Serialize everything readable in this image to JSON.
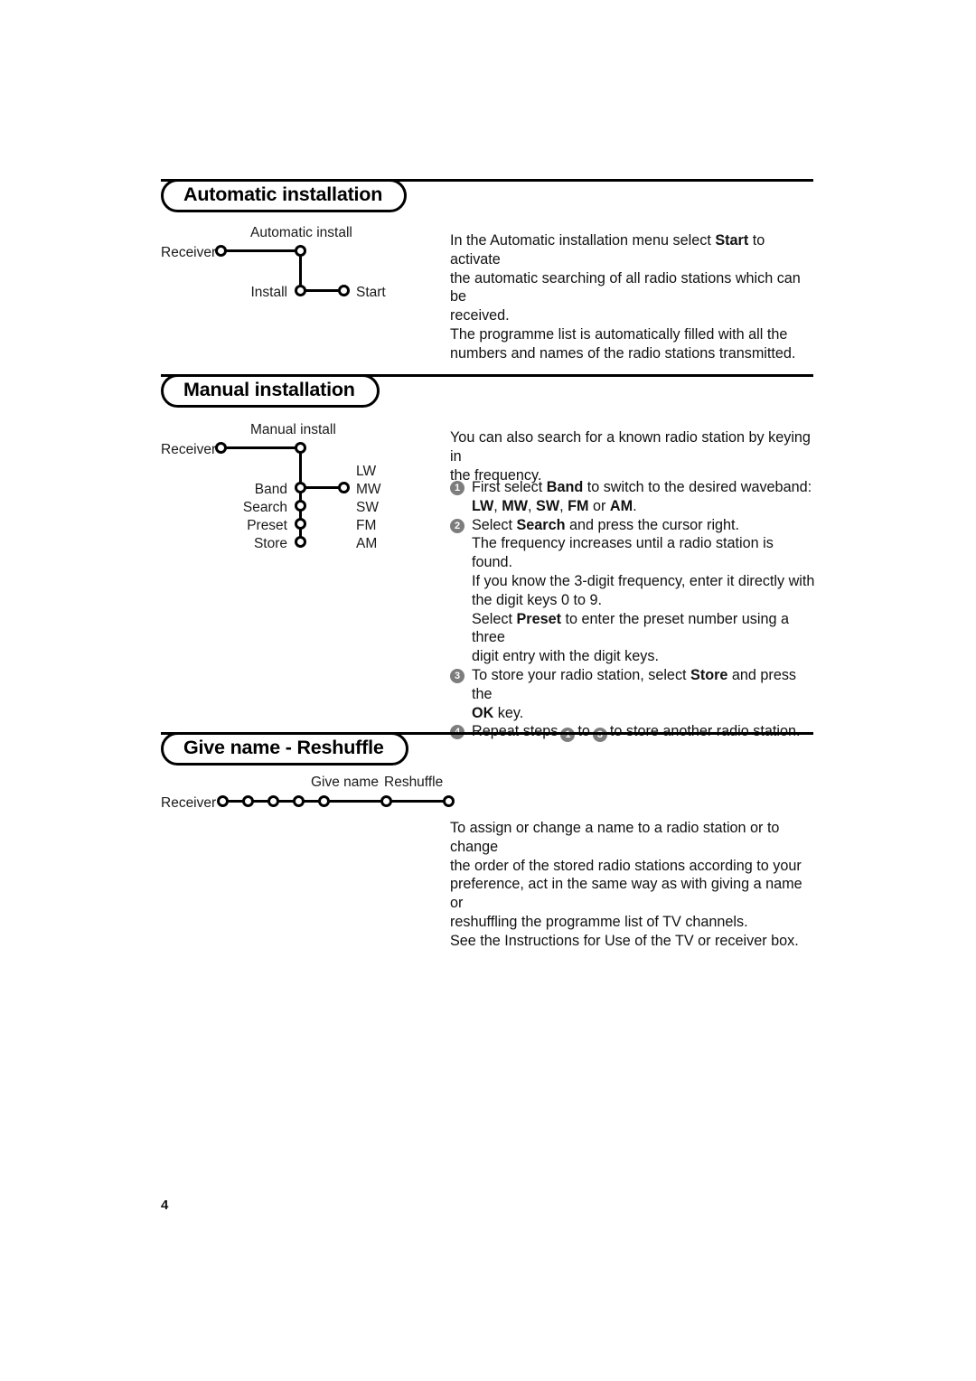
{
  "page": {
    "number": "4"
  },
  "sections": [
    {
      "id": "automatic-installation",
      "title": "Automatic installation",
      "diagram": {
        "name": "automatic-install-menu-tree",
        "labels": {
          "receiver": "Receiver",
          "menu": "Automatic install",
          "install": "Install",
          "start": "Start"
        }
      },
      "body": [
        "In the Automatic installation menu select ",
        "Start",
        " to activate the automatic searching of all radio stations which can be received.",
        "The programme list is automatically filled with all the numbers and names of the radio stations transmitted."
      ],
      "body_lines": [
        "In the Automatic installation menu select Start to activate",
        "the automatic searching of all radio stations which can be",
        "received.",
        "The programme list is automatically filled with all the",
        "numbers and names of the radio stations transmitted."
      ]
    },
    {
      "id": "manual-installation",
      "title": "Manual installation",
      "diagram": {
        "name": "manual-install-menu-tree",
        "labels": {
          "receiver": "Receiver",
          "menu": "Manual install",
          "band": "Band",
          "search": "Search",
          "preset": "Preset",
          "store": "Store"
        },
        "wavebands": [
          "LW",
          "MW",
          "SW",
          "FM",
          "AM"
        ]
      },
      "intro_lines": [
        "You can also search for a known radio station by keying in",
        "the frequency."
      ],
      "steps": [
        {
          "number": "1",
          "lines": [
            "First select Band to switch to the desired waveband:",
            "LW, MW, SW, FM or AM."
          ]
        },
        {
          "number": "2",
          "lines": [
            "Select Search and press the cursor right.",
            "The frequency increases until a radio station is found.",
            "If you know the 3-digit frequency, enter it directly with",
            "the digit keys 0 to 9.",
            "Select Preset to enter the preset number using a three",
            "digit entry with the digit keys."
          ]
        },
        {
          "number": "3",
          "lines": [
            "To store your radio station, select Store and press the",
            "OK key."
          ]
        },
        {
          "number": "4",
          "lines": [
            "Repeat steps 1 to 3 to store another radio station."
          ],
          "inline_refs": [
            "1",
            "3"
          ],
          "parts": {
            "prefix": "Repeat steps",
            "middle": "to",
            "suffix": "to store another radio station."
          }
        }
      ]
    },
    {
      "id": "give-name-reshuffle",
      "title": "Give name - Reshuffle",
      "diagram": {
        "name": "give-name-reshuffle-chain",
        "labels": {
          "receiver": "Receiver",
          "give_name": "Give name",
          "reshuffle": "Reshuffle"
        },
        "node_count": 7
      },
      "body_lines": [
        "To assign or change a name to a radio station or to change",
        "the order of the stored radio stations according to your",
        "preference, act in the same way as with giving a name or",
        "reshuffling the programme list of TV channels.",
        "See the Instructions for Use of the TV or receiver box."
      ]
    }
  ],
  "colors": {
    "ink": "#000000",
    "text": "#111111",
    "bullet": "#7d7d7d",
    "paper": "#ffffff"
  }
}
